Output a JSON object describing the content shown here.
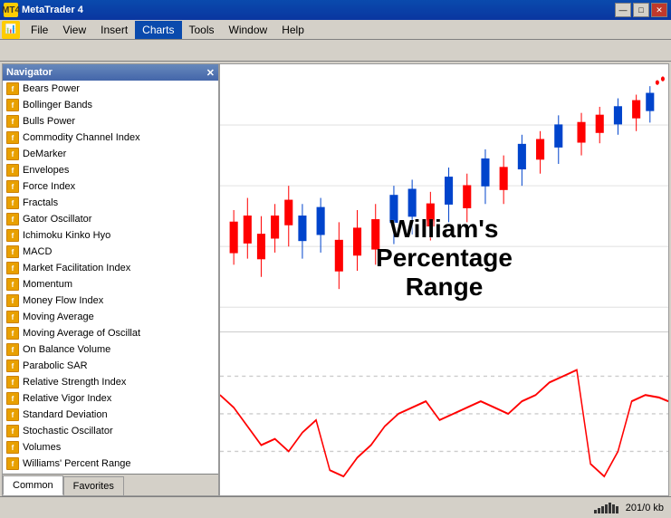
{
  "window": {
    "title": "MetaTrader 4",
    "icon": "MT4"
  },
  "titlebar": {
    "minimize": "—",
    "maximize": "□",
    "close": "✕"
  },
  "menubar": {
    "items": [
      {
        "id": "file",
        "label": "File"
      },
      {
        "id": "view",
        "label": "View"
      },
      {
        "id": "insert",
        "label": "Insert"
      },
      {
        "id": "charts",
        "label": "Charts"
      },
      {
        "id": "tools",
        "label": "Tools"
      },
      {
        "id": "window",
        "label": "Window"
      },
      {
        "id": "help",
        "label": "Help"
      }
    ],
    "active": "charts"
  },
  "navigator": {
    "title": "Navigator",
    "items": [
      {
        "id": "bears-power",
        "label": "Bears Power"
      },
      {
        "id": "bollinger-bands",
        "label": "Bollinger Bands"
      },
      {
        "id": "bulls-power",
        "label": "Bulls Power"
      },
      {
        "id": "commodity-channel-index",
        "label": "Commodity Channel Index"
      },
      {
        "id": "demarker",
        "label": "DeMarker"
      },
      {
        "id": "envelopes",
        "label": "Envelopes"
      },
      {
        "id": "force-index",
        "label": "Force Index"
      },
      {
        "id": "fractals",
        "label": "Fractals"
      },
      {
        "id": "gator-oscillator",
        "label": "Gator Oscillator"
      },
      {
        "id": "ichimoku-kinko-hyo",
        "label": "Ichimoku Kinko Hyo"
      },
      {
        "id": "macd",
        "label": "MACD"
      },
      {
        "id": "market-facilitation-index",
        "label": "Market Facilitation Index"
      },
      {
        "id": "momentum",
        "label": "Momentum"
      },
      {
        "id": "money-flow-index",
        "label": "Money Flow Index"
      },
      {
        "id": "moving-average",
        "label": "Moving Average"
      },
      {
        "id": "moving-average-oscillat",
        "label": "Moving Average of Oscillat"
      },
      {
        "id": "on-balance-volume",
        "label": "On Balance Volume"
      },
      {
        "id": "parabolic-sar",
        "label": "Parabolic SAR"
      },
      {
        "id": "relative-strength-index",
        "label": "Relative Strength Index"
      },
      {
        "id": "relative-vigor-index",
        "label": "Relative Vigor Index"
      },
      {
        "id": "standard-deviation",
        "label": "Standard Deviation"
      },
      {
        "id": "stochastic-oscillator",
        "label": "Stochastic Oscillator"
      },
      {
        "id": "volumes",
        "label": "Volumes"
      },
      {
        "id": "williams-percent-range",
        "label": "Williams' Percent Range"
      }
    ],
    "tabs": [
      {
        "id": "common",
        "label": "Common",
        "active": true
      },
      {
        "id": "favorites",
        "label": "Favorites",
        "active": false
      }
    ]
  },
  "chart": {
    "label_line1": "William's Percentage",
    "label_line2": "Range"
  },
  "statusbar": {
    "memory": "201/0 kb"
  }
}
